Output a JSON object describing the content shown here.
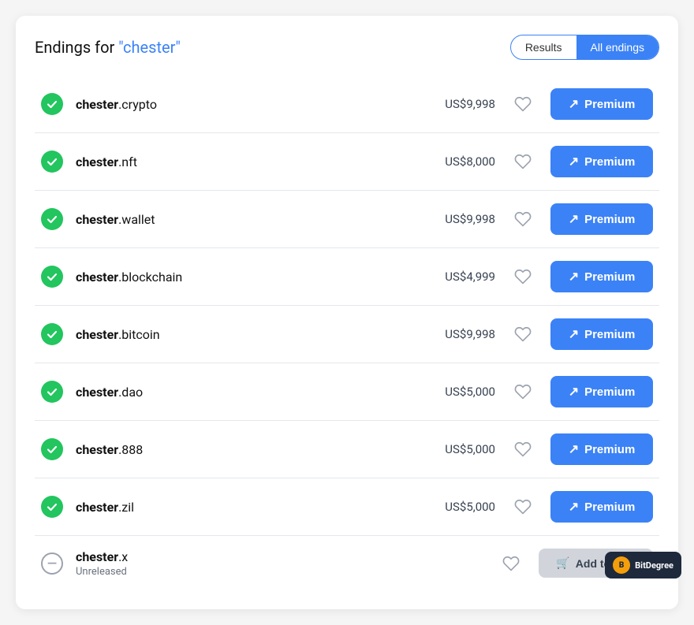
{
  "header": {
    "title_prefix": "Endings for ",
    "query": "\"chester\"",
    "toggle": {
      "options": [
        "Results",
        "All endings"
      ],
      "active": "All endings"
    }
  },
  "domains": [
    {
      "id": 1,
      "base": "chester",
      "ext": ".crypto",
      "status": "available",
      "price": "US$9,998",
      "button_type": "premium",
      "button_label": "Premium",
      "sub": null
    },
    {
      "id": 2,
      "base": "chester",
      "ext": ".nft",
      "status": "available",
      "price": "US$8,000",
      "button_type": "premium",
      "button_label": "Premium",
      "sub": null
    },
    {
      "id": 3,
      "base": "chester",
      "ext": ".wallet",
      "status": "available",
      "price": "US$9,998",
      "button_type": "premium",
      "button_label": "Premium",
      "sub": null
    },
    {
      "id": 4,
      "base": "chester",
      "ext": ".blockchain",
      "status": "available",
      "price": "US$4,999",
      "button_type": "premium",
      "button_label": "Premium",
      "sub": null
    },
    {
      "id": 5,
      "base": "chester",
      "ext": ".bitcoin",
      "status": "available",
      "price": "US$9,998",
      "button_type": "premium",
      "button_label": "Premium",
      "sub": null
    },
    {
      "id": 6,
      "base": "chester",
      "ext": ".dao",
      "status": "available",
      "price": "US$5,000",
      "button_type": "premium",
      "button_label": "Premium",
      "sub": null
    },
    {
      "id": 7,
      "base": "chester",
      "ext": ".888",
      "status": "available",
      "price": "US$5,000",
      "button_type": "premium",
      "button_label": "Premium",
      "sub": null
    },
    {
      "id": 8,
      "base": "chester",
      "ext": ".zil",
      "status": "available",
      "price": "US$5,000",
      "button_type": "premium",
      "button_label": "Premium",
      "sub": null
    },
    {
      "id": 9,
      "base": "chester",
      "ext": ".x",
      "status": "unreleased",
      "price": "",
      "button_type": "add-to-cart",
      "button_label": "Add to Cart",
      "sub": "Unreleased"
    }
  ],
  "watermark": {
    "logo": "B",
    "label": "BitDegree"
  }
}
